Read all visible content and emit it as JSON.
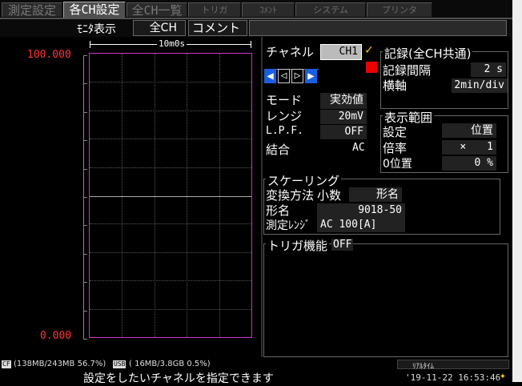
{
  "tabs": [
    {
      "label": "測定設定",
      "active": false
    },
    {
      "label": "各CH設定",
      "active": true
    },
    {
      "label": "全CH一覧",
      "active": false
    },
    {
      "label": "トリガ",
      "active": false
    },
    {
      "label": "ｺﾒﾝﾄ",
      "active": false
    },
    {
      "label": "システム",
      "active": false
    },
    {
      "label": "プリンタ",
      "active": false
    }
  ],
  "monitor": {
    "label": "ﾓﾆﾀ表示",
    "value": "全CH",
    "comment_label": "コメント",
    "comment_value": ""
  },
  "graph": {
    "time_div": "10m0s",
    "y_top": "100.000",
    "y_bottom": "0.000",
    "trace_color": "#cc33cc",
    "axis_label_color": "#ff3333",
    "grid_cols": 5,
    "grid_rows": 10
  },
  "channel": {
    "label": "チャネル",
    "value": "CH1",
    "check_icon": "check-icon",
    "color_swatch": "#ee0000",
    "mode_label": "モード",
    "mode_value": "実効値",
    "range_label": "レンジ",
    "range_value": "20mV",
    "lpf_label": "L.P.F.",
    "lpf_value": "OFF",
    "coupling_label": "結合",
    "coupling_value": "AC"
  },
  "recording": {
    "title": "記録(全CH共通)",
    "interval_label": "記録間隔",
    "interval_value": "2 s",
    "haxis_label": "横軸",
    "haxis_value": "2min/div"
  },
  "display_range": {
    "title": "表示範囲",
    "setting_label": "設定",
    "setting_value": "位置",
    "zoom_label": "倍率",
    "zoom_symbol": "×",
    "zoom_value": "1",
    "zero_label": "0位置",
    "zero_value": "0 %"
  },
  "scaling": {
    "title": "スケーリング",
    "method_label": "変換方法",
    "method_value": "小数",
    "type_label": "形名",
    "model_label": "形名",
    "model_value": "9018-50",
    "meas_range_label": "測定ﾚﾝｼﾞ",
    "meas_range_value": "AC  100[A]"
  },
  "trigger": {
    "label": "トリガ機能",
    "value": "OFF"
  },
  "statusbar": {
    "cf_badge": "CF",
    "cf_text": "(138MB/243MB 56.7%)",
    "usb_badge": "USB",
    "usb_text": "( 16MB/3.8GB  0.5%)",
    "realtime_label": "ﾘｱﾙﾀｲﾑ",
    "hint": "設定をしたいチャネルを指定できます",
    "datetime": "'19-11-22 16:53:46"
  }
}
